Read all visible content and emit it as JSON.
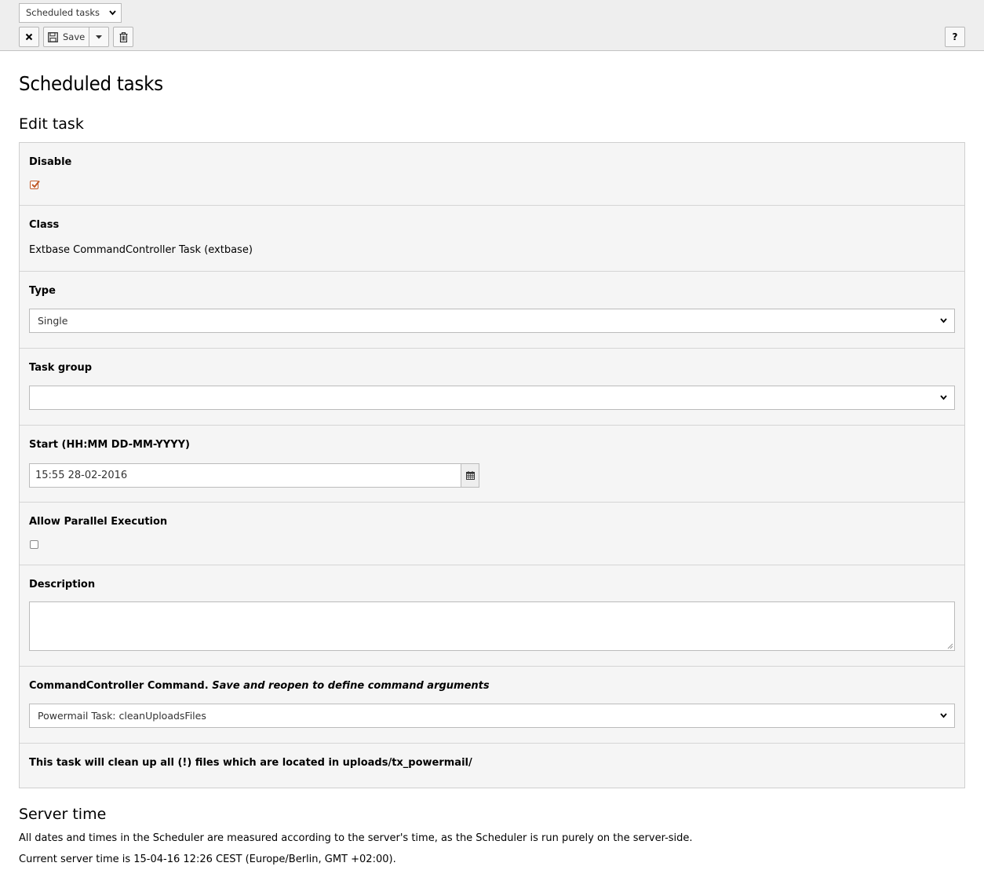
{
  "toolbar": {
    "module_select_value": "Scheduled tasks",
    "save_label": "Save",
    "help_label": "?",
    "icons": [
      "close-icon",
      "save-icon",
      "caret-down-icon",
      "trash-icon",
      "help-icon"
    ]
  },
  "page": {
    "title": "Scheduled tasks",
    "section": "Edit task"
  },
  "form": {
    "disable": {
      "label": "Disable",
      "checked": true
    },
    "class": {
      "label": "Class",
      "value": "Extbase CommandController Task (extbase)"
    },
    "type": {
      "label": "Type",
      "value": "Single"
    },
    "task_group": {
      "label": "Task group",
      "value": ""
    },
    "start": {
      "label": "Start (HH:MM DD-MM-YYYY)",
      "value": "15:55 28-02-2016"
    },
    "parallel": {
      "label": "Allow Parallel Execution",
      "checked": false
    },
    "description": {
      "label": "Description",
      "value": ""
    },
    "command": {
      "label": "CommandController Command.",
      "label_hint": "Save and reopen to define command arguments",
      "value": "Powermail Task: cleanUploadsFiles"
    },
    "info": "This task will clean up all (!) files which are located in uploads/tx_powermail/"
  },
  "server": {
    "title": "Server time",
    "description": "All dates and times in the Scheduler are measured according to the server's time, as the Scheduler is run purely on the server-side.",
    "current": "Current server time is 15-04-16 12:26 CEST (Europe/Berlin, GMT +02:00)."
  },
  "colors": {
    "toolbar_bg": "#eeeeee",
    "panel_bg": "#f5f5f5",
    "checkbox_accent": "#c05a28"
  }
}
